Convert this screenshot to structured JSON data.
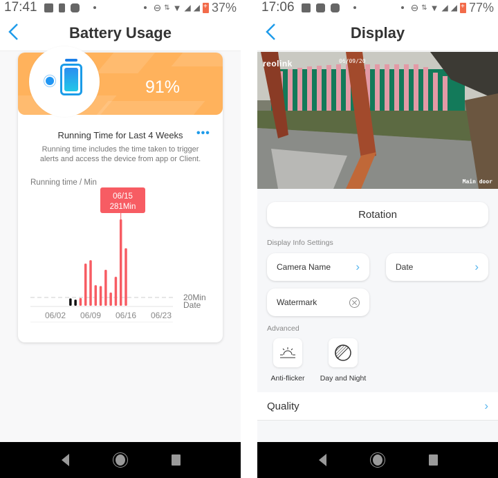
{
  "left": {
    "status": {
      "time": "17:41",
      "battery": "37%"
    },
    "header": {
      "title": "Battery Usage",
      "back_icon": "chevron-left-icon"
    },
    "battery": {
      "level": "91%",
      "icon": "battery-solar-icon"
    },
    "running": {
      "title": "Running Time for Last 4 Weeks",
      "more_icon": "more-horizontal-icon",
      "description": "Running time includes the time taken to trigger alerts and access the device from app or Client.",
      "y_label": "Running time  / Min"
    },
    "tooltip": {
      "date": "06/15",
      "value": "281Min"
    },
    "chart_labels": {
      "threshold": "20Min",
      "axis": "Date"
    }
  },
  "chart_data": {
    "type": "bar",
    "title": "Running Time for Last 4 Weeks",
    "ylabel": "Running time / Min",
    "xlabel": "Date",
    "x_ticks": [
      "06/02",
      "06/09",
      "06/16",
      "06/23"
    ],
    "reference_line": {
      "value": 20,
      "label": "20Min"
    },
    "highlight": {
      "date": "06/15",
      "value": 281
    },
    "categories": [
      "06/05",
      "06/06",
      "06/07",
      "06/08",
      "06/09",
      "06/10",
      "06/11",
      "06/12",
      "06/13",
      "06/14",
      "06/15",
      "06/16"
    ],
    "values": [
      24,
      20,
      25,
      137,
      148,
      67,
      64,
      117,
      43,
      94,
      281,
      187
    ],
    "colors": [
      "#111111",
      "#111111",
      "#f75c63",
      "#f75c63",
      "#f75c63",
      "#f75c63",
      "#f75c63",
      "#f75c63",
      "#f75c63",
      "#f75c63",
      "#f75c63",
      "#f75c63"
    ],
    "x_range": [
      "05/29",
      "06/24"
    ],
    "ylim": [
      0,
      300
    ]
  },
  "right": {
    "status": {
      "time": "17:06",
      "battery": "77%"
    },
    "header": {
      "title": "Display",
      "back_icon": "chevron-left-icon"
    },
    "camera": {
      "brand_overlay": "reolink",
      "date_overlay": "06/09/20",
      "name_overlay": "Main door"
    },
    "rotation_label": "Rotation",
    "display_info": {
      "section_label": "Display Info Settings",
      "camera_name": "Camera Name",
      "date": "Date",
      "watermark": "Watermark"
    },
    "advanced": {
      "section_label": "Advanced",
      "anti_flicker": "Anti-flicker",
      "day_night": "Day and Night"
    },
    "quality_label": "Quality"
  }
}
